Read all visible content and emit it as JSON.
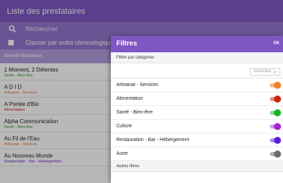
{
  "appbar": {
    "title": "Liste des prestataires"
  },
  "search": {
    "placeholder": "Rechercher"
  },
  "chrono": {
    "label": "Classer par ordre chronologique"
  },
  "group": {
    "label": "Alvéole Bordeaux"
  },
  "list": [
    {
      "name": "1 Moment, 2 Détentes",
      "category": "Santé - Bien-être",
      "color": "#2e9b2e"
    },
    {
      "name": "A D I D",
      "category": "Artisanat - Services",
      "color": "#f26a21"
    },
    {
      "name": "A Portée d'Bio",
      "category": "Alimentation",
      "color": "#c62828"
    },
    {
      "name": "Alpha Communication",
      "category": "Santé - Bien-être",
      "color": "#2e9b2e"
    },
    {
      "name": "Au Fil de l'Eau",
      "category": "Artisanat - Services",
      "color": "#f26a21"
    },
    {
      "name": "Au Nouveau Monde",
      "category": "Restauration - Bar - Hébergement",
      "color": "#6a1fd0"
    }
  ],
  "panel": {
    "title": "Filtres",
    "ok": "OK",
    "by_category": "Filtrer par catégories",
    "invert": "INVERSER",
    "other_filters": "Autres filtres",
    "filters": [
      {
        "label": "Artisanat - Services",
        "color": "#f7801e",
        "track": "#f9b585",
        "on": true
      },
      {
        "label": "Alimentation",
        "color": "#c9260f",
        "track": "#e88a76",
        "on": true
      },
      {
        "label": "Santé - Bien-être",
        "color": "#16b51c",
        "track": "#86db87",
        "on": true
      },
      {
        "label": "Culture",
        "color": "#a526d9",
        "track": "#d69aee",
        "on": true
      },
      {
        "label": "Restauration - Bar - Hébergement",
        "color": "#5e1fdb",
        "track": "#ab8ded",
        "on": true
      },
      {
        "label": "Autre",
        "color": "#6b6b6b",
        "track": "#b2b2b2",
        "on": true
      }
    ]
  },
  "icons": {
    "search": "search-icon",
    "invert": "swap-icon"
  },
  "colors": {
    "primary": "#7e57c2",
    "primary_light": "#9575cd"
  }
}
